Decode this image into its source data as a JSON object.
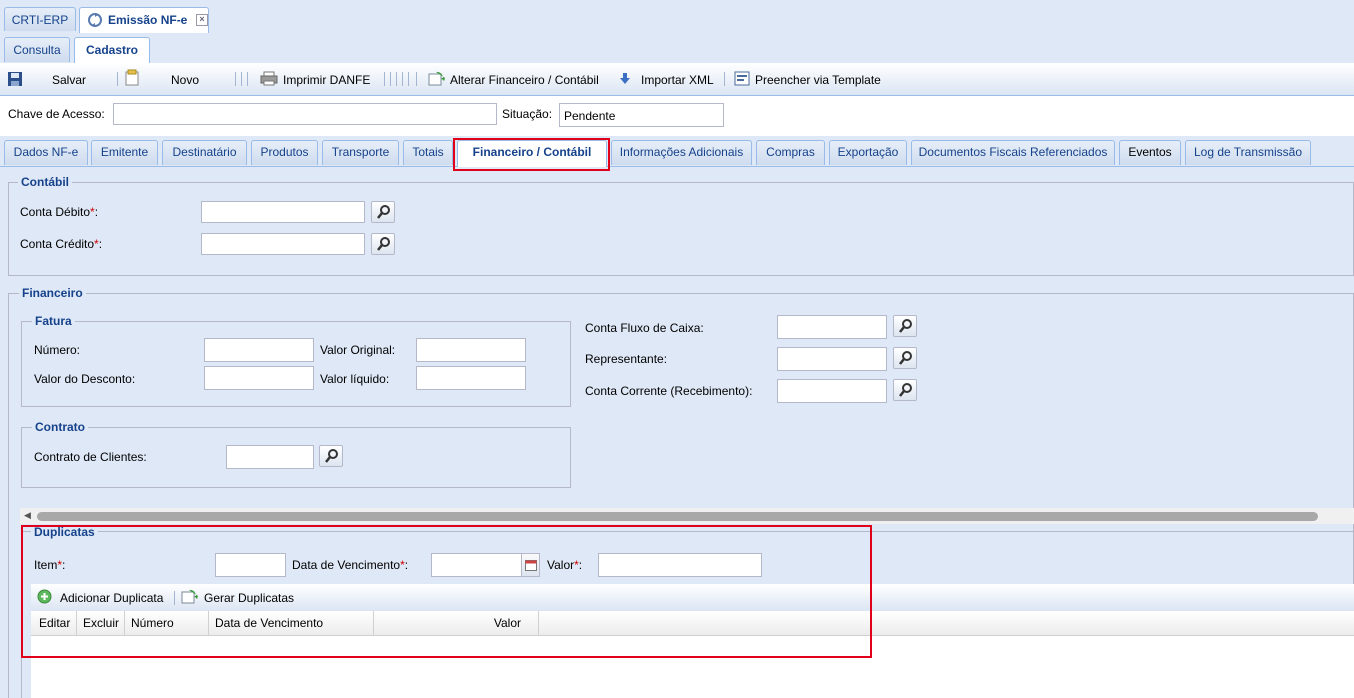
{
  "window_tabs": [
    {
      "label": "CRTI-ERP"
    },
    {
      "label": "Emissão NF-e"
    }
  ],
  "mode_tabs": [
    {
      "label": "Consulta"
    },
    {
      "label": "Cadastro"
    }
  ],
  "toolbar": {
    "save": "Salvar",
    "new": "Novo",
    "print": "Imprimir DANFE",
    "alter_fin": "Alterar Financeiro / Contábil",
    "import_xml": "Importar XML",
    "template": "Preencher via Template"
  },
  "header_form": {
    "chave_label": "Chave de Acesso:",
    "chave_value": "",
    "situacao_label": "Situação:",
    "situacao_value": "Pendente"
  },
  "form_tabs": [
    {
      "label": "Dados NF-e"
    },
    {
      "label": "Emitente"
    },
    {
      "label": "Destinatário"
    },
    {
      "label": "Produtos"
    },
    {
      "label": "Transporte"
    },
    {
      "label": "Totais"
    },
    {
      "label": "Financeiro / Contábil"
    },
    {
      "label": "Informações Adicionais"
    },
    {
      "label": "Compras"
    },
    {
      "label": "Exportação"
    },
    {
      "label": "Documentos Fiscais Referenciados"
    },
    {
      "label": "Eventos"
    },
    {
      "label": "Log de Transmissão"
    }
  ],
  "contabil": {
    "legend": "Contábil",
    "debito_label": "Conta Débito",
    "credito_label": "Conta Crédito",
    "req_mark": "*",
    "colon": ":"
  },
  "financeiro": {
    "legend": "Financeiro",
    "fatura_legend": "Fatura",
    "numero_label": "Número:",
    "valor_original_label": "Valor Original:",
    "valor_desconto_label": "Valor do Desconto:",
    "valor_liquido_label": "Valor líquido:",
    "contrato_legend": "Contrato",
    "contrato_clientes_label": "Contrato de Clientes:",
    "fluxo_caixa_label": "Conta Fluxo de Caixa:",
    "representante_label": "Representante:",
    "conta_corrente_label": "Conta Corrente (Recebimento):"
  },
  "duplicatas": {
    "legend": "Duplicatas",
    "item_label": "Item",
    "vencimento_label": "Data de Vencimento",
    "valor_label": "Valor",
    "add_button": "Adicionar Duplicata",
    "generate_button": "Gerar Duplicatas",
    "columns": [
      "Editar",
      "Excluir",
      "Número",
      "Data de Vencimento",
      "Valor"
    ]
  },
  "colors": {
    "accent": "#15428b",
    "highlight": "#e0001a",
    "background": "#dfe8f6"
  }
}
